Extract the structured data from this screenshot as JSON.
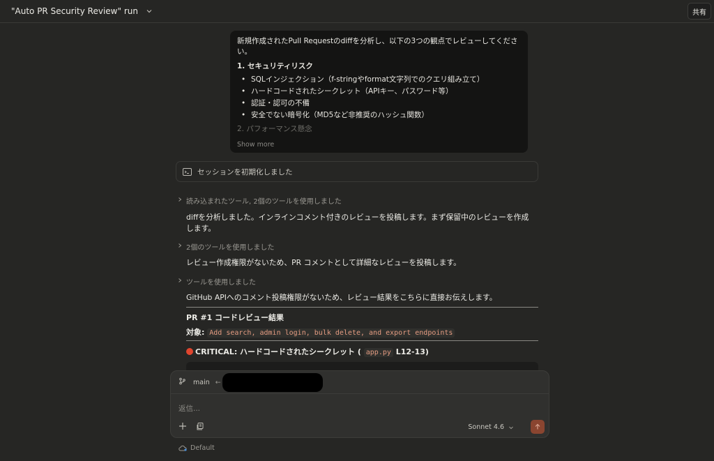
{
  "header": {
    "title": "\"Auto PR Security Review\" run",
    "share_label": "共有"
  },
  "user_message": {
    "intro": "新規作成されたPull Requestのdiffを分析し、以下の3つの観点でレビューしてください。",
    "section1_title": "1. セキュリティリスク",
    "section1_items": [
      "SQLインジェクション（f-stringやformat文字列でのクエリ組み立て）",
      "ハードコードされたシークレット（APIキー、パスワード等）",
      "認証・認可の不備",
      "安全でない暗号化（MD5など非推奨のハッシュ関数）"
    ],
    "section2_title": "2. パフォーマンス懸念",
    "show_more": "Show more"
  },
  "session": {
    "label": "セッションを初期化しました"
  },
  "transcript": {
    "tool1": "読み込まれたツール, 2個のツールを使用しました",
    "para1": "diffを分析しました。インラインコメント付きのレビューを投稿します。まず保留中のレビューを作成します。",
    "tool2": "2個のツールを使用しました",
    "para2": "レビュー作成権限がないため、PR コメントとして詳細なレビューを投稿します。",
    "tool3": "ツールを使用しました",
    "para3": "GitHub APIへのコメント投稿権限がないため、レビュー結果をこちらに直接お伝えします。",
    "h_review": "PR #1 コードレビュー結果",
    "target_label": "対象:",
    "target_code": "Add search, admin login, bulk delete, and export endpoints",
    "critical_prefix": "CRITICAL: ハードコードされたシークレット (",
    "critical_code": "app.py",
    "critical_suffix": "L12-13)"
  },
  "composer": {
    "branch": "main",
    "placeholder": "返信...",
    "model": "Sonnet 4.6",
    "environment": "Default"
  }
}
